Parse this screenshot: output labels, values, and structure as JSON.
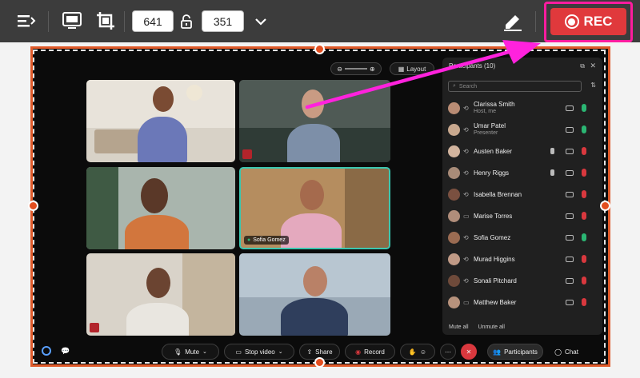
{
  "toolbar": {
    "width_value": "641",
    "height_value": "351",
    "rec_label": "REC"
  },
  "meeting": {
    "layout_label": "Layout",
    "panel": {
      "header_hint": "Participants (10)",
      "search_placeholder": "Search",
      "participants": [
        {
          "name": "Clarissa Smith",
          "sub": "Host, me",
          "mic": "on"
        },
        {
          "name": "Umar Patel",
          "sub": "Presenter",
          "mic": "on"
        },
        {
          "name": "Austen Baker",
          "sub": "",
          "mic": "off"
        },
        {
          "name": "Henry Riggs",
          "sub": "",
          "mic": "off"
        },
        {
          "name": "Isabella Brennan",
          "sub": "",
          "mic": "off"
        },
        {
          "name": "Marise Torres",
          "sub": "",
          "mic": "off"
        },
        {
          "name": "Sofia Gomez",
          "sub": "",
          "mic": "on"
        },
        {
          "name": "Murad Higgins",
          "sub": "",
          "mic": "off"
        },
        {
          "name": "Sonali Pitchard",
          "sub": "",
          "mic": "off"
        },
        {
          "name": "Matthew Baker",
          "sub": "",
          "mic": "off"
        }
      ],
      "mute_all": "Mute all",
      "unmute_all": "Unmute all"
    },
    "tile_label": "Sofia Gomez",
    "bottom_bar": {
      "mute": "Mute",
      "stop_video": "Stop video",
      "share": "Share",
      "record": "Record",
      "participants": "Participants",
      "chat": "Chat"
    }
  },
  "colors": {
    "accent_rec": "#e0393c",
    "highlight": "#ff1c9e",
    "region": "#e05a2a",
    "mic_on": "#2bb673",
    "mic_off": "#d9383e"
  }
}
